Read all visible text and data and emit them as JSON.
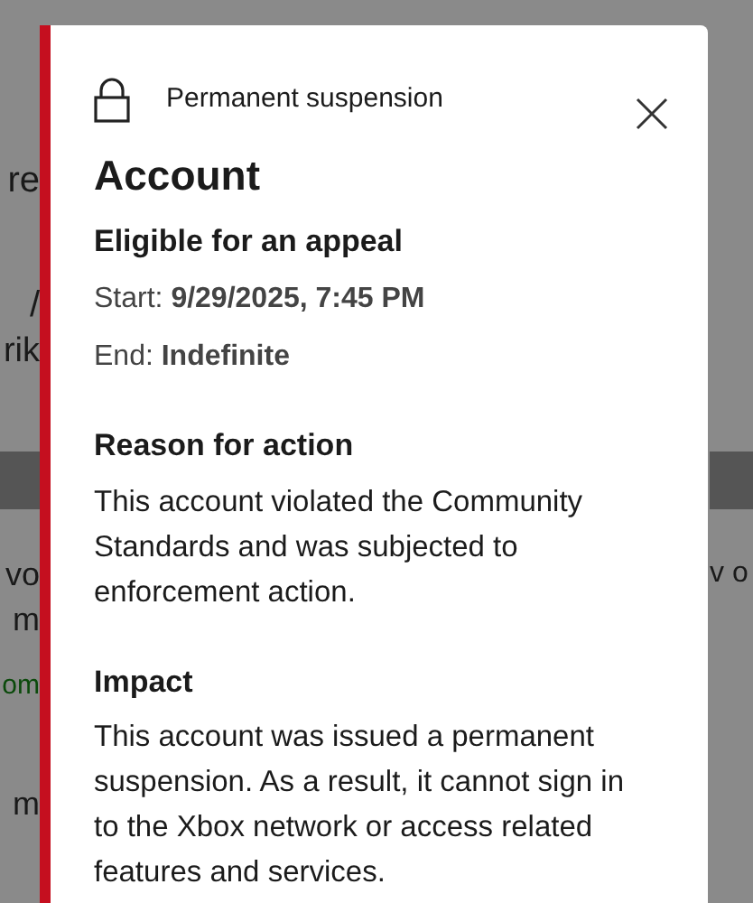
{
  "background_left": [
    {
      "text": "re",
      "color": "#1a1a1a"
    },
    {
      "text": "/",
      "color": "#1a1a1a"
    },
    {
      "text": "rik",
      "color": "#1a1a1a"
    },
    {
      "text": "vo",
      "color": "#1a1a1a"
    },
    {
      "text": "m",
      "color": "#1a1a1a"
    },
    {
      "text": "om",
      "color": "#0b4a0b"
    },
    {
      "text": "m",
      "color": "#1a1a1a"
    }
  ],
  "background_right": [
    {
      "text": "v o",
      "color": "#1a1a1a"
    }
  ],
  "dialog": {
    "header": "Permanent suspension",
    "title": "Account",
    "appeal_status": "Eligible for an appeal",
    "details": [
      "Start: **9/29/2025, 7:45 PM**",
      "End: **Indefinite**"
    ],
    "sections": [
      {
        "heading": "Reason for action",
        "body": "This account violated the Community Standards and was subjected to enforcement action."
      },
      {
        "heading": "Impact",
        "body": "This account was issued a permanent suspension. As a result, it cannot sign in to the Xbox network or access related features and services."
      }
    ]
  }
}
